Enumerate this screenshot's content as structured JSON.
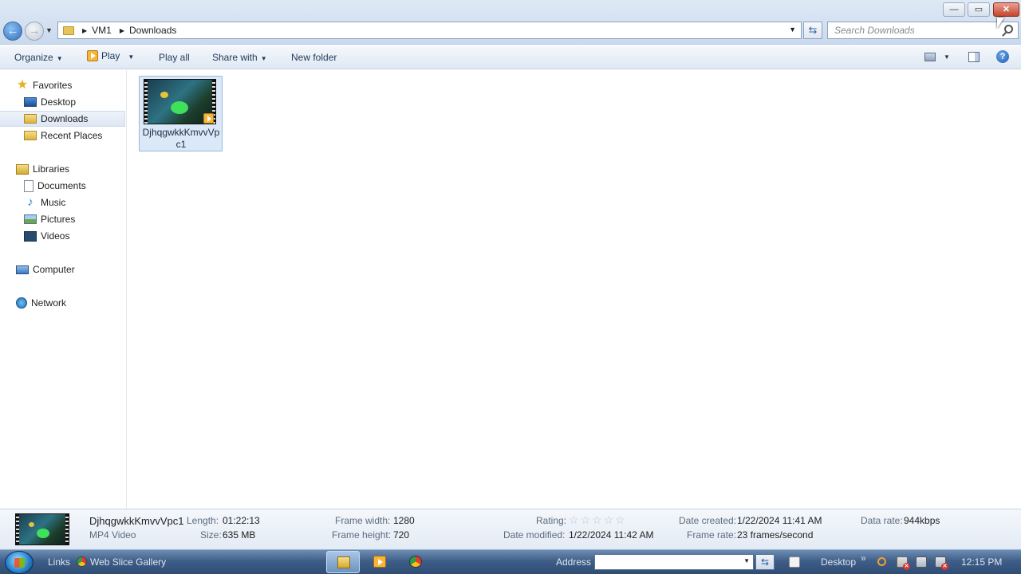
{
  "window": {
    "controls": {
      "minimize": "—",
      "maximize": "▭",
      "close": "✕"
    }
  },
  "address_bar": {
    "breadcrumbs": [
      "VM1",
      "Downloads"
    ],
    "search_placeholder": "Search Downloads"
  },
  "toolbar": {
    "organize": "Organize",
    "play": "Play",
    "play_all": "Play all",
    "share_with": "Share with",
    "new_folder": "New folder",
    "help": "?"
  },
  "nav_pane": {
    "favorites": "Favorites",
    "favorites_items": [
      "Desktop",
      "Downloads",
      "Recent Places"
    ],
    "libraries": "Libraries",
    "libraries_items": [
      "Documents",
      "Music",
      "Pictures",
      "Videos"
    ],
    "computer": "Computer",
    "network": "Network",
    "selected": "Downloads"
  },
  "files": [
    {
      "name": "DjhqgwkkKmvvVpc1",
      "type": "MP4 Video",
      "icon": "video-thumbnail"
    }
  ],
  "details": {
    "name": "DjhqgwkkKmvvVpc1",
    "type": "MP4 Video",
    "length_label": "Length:",
    "length": "01:22:13",
    "size_label": "Size:",
    "size": "635 MB",
    "frame_width_label": "Frame width:",
    "frame_width": "1280",
    "frame_height_label": "Frame height:",
    "frame_height": "720",
    "rating_label": "Rating:",
    "rating": 0,
    "rating_max": 5,
    "date_modified_label": "Date modified:",
    "date_modified": "1/22/2024 11:42 AM",
    "date_created_label": "Date created:",
    "date_created": "1/22/2024 11:41 AM",
    "frame_rate_label": "Frame rate:",
    "frame_rate": "23 frames/second",
    "data_rate_label": "Data rate:",
    "data_rate": "944kbps"
  },
  "taskbar": {
    "links": "Links",
    "web_slice_gallery": "Web Slice Gallery",
    "address_label": "Address",
    "desktop_label": "Desktop",
    "chevron": "»",
    "clock": "12:15 PM"
  },
  "colors": {
    "accent": "#2f6fbf",
    "selection": "#dbe8f7",
    "taskbar": "#3f5f88"
  }
}
